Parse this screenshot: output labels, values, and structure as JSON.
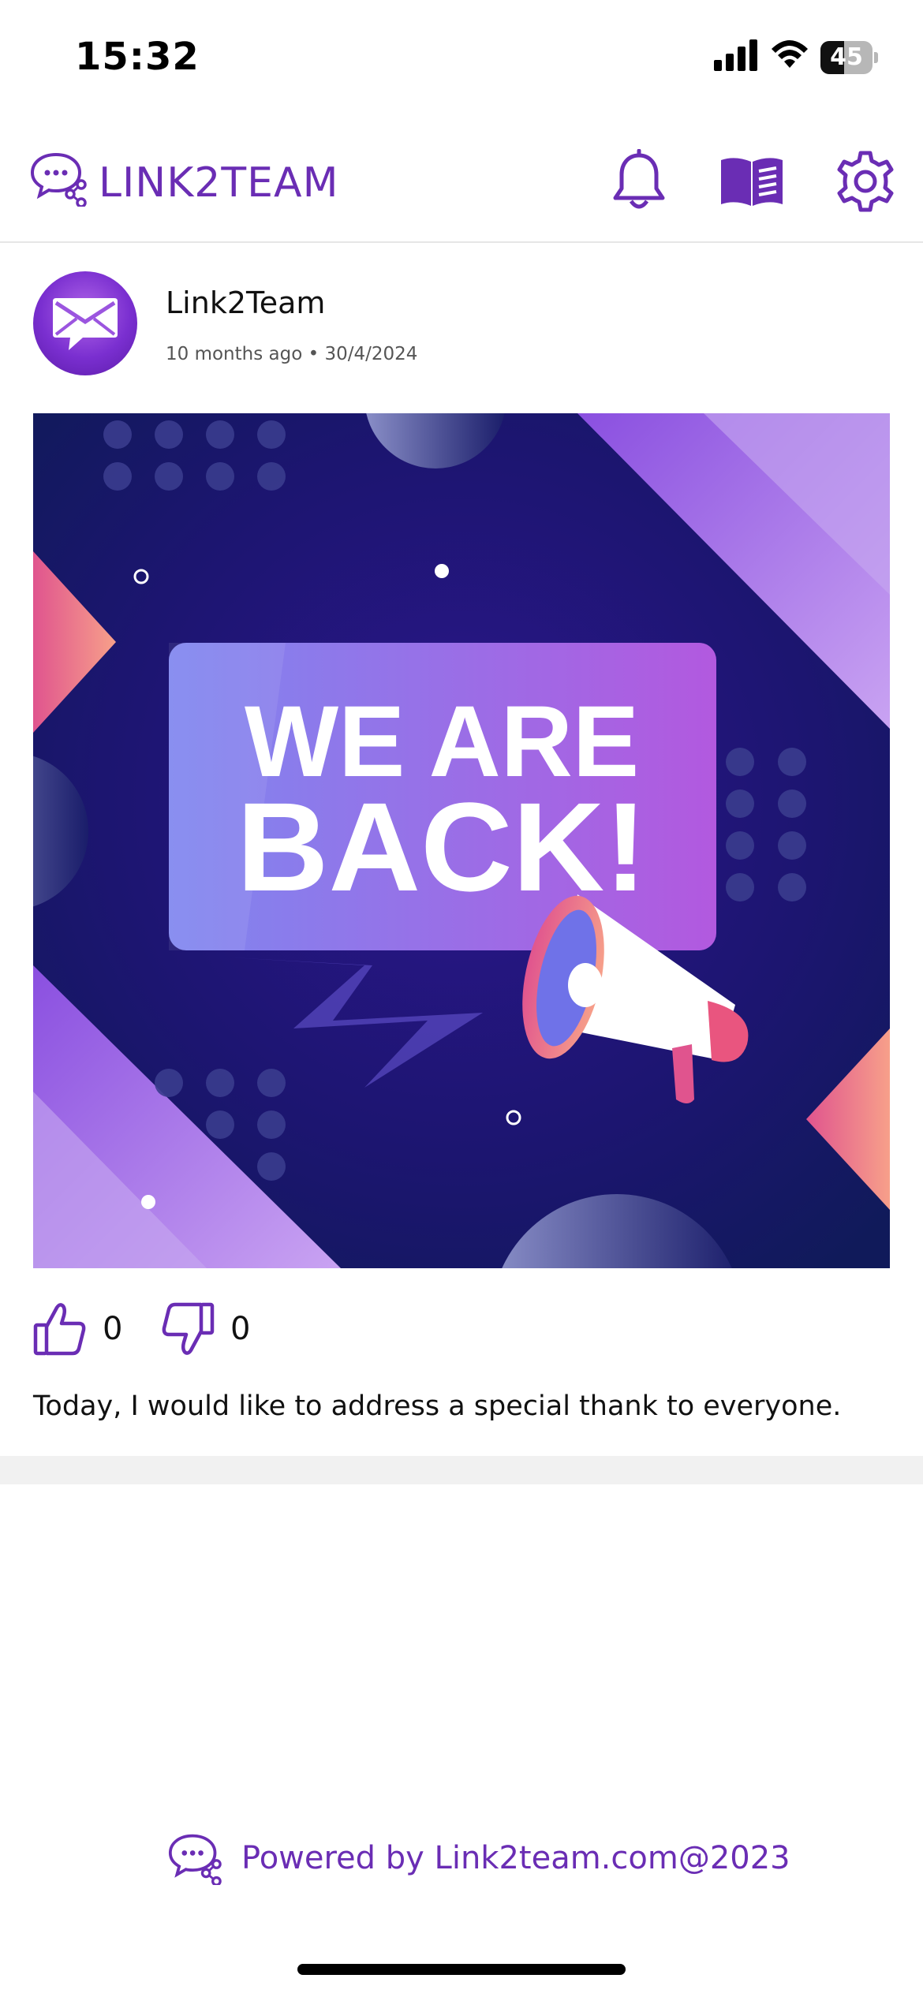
{
  "status_bar": {
    "time": "15:32",
    "battery_level": "45",
    "battery_fraction": 0.45
  },
  "app_bar": {
    "brand": "LINK2TEAM",
    "icons": [
      "chat-share-logo-icon",
      "bell-icon",
      "book-icon",
      "gear-icon"
    ],
    "accent_color": "#6a2db4"
  },
  "post": {
    "author": "Link2Team",
    "meta": "10 months ago • 30/4/2024",
    "image": {
      "headline_line1": "WE ARE",
      "headline_line2": "BACK!"
    },
    "likes": "0",
    "dislikes": "0",
    "caption": "Today, I would like to address a special thank to everyone."
  },
  "footer": {
    "text": "Powered by Link2team.com@2023"
  }
}
